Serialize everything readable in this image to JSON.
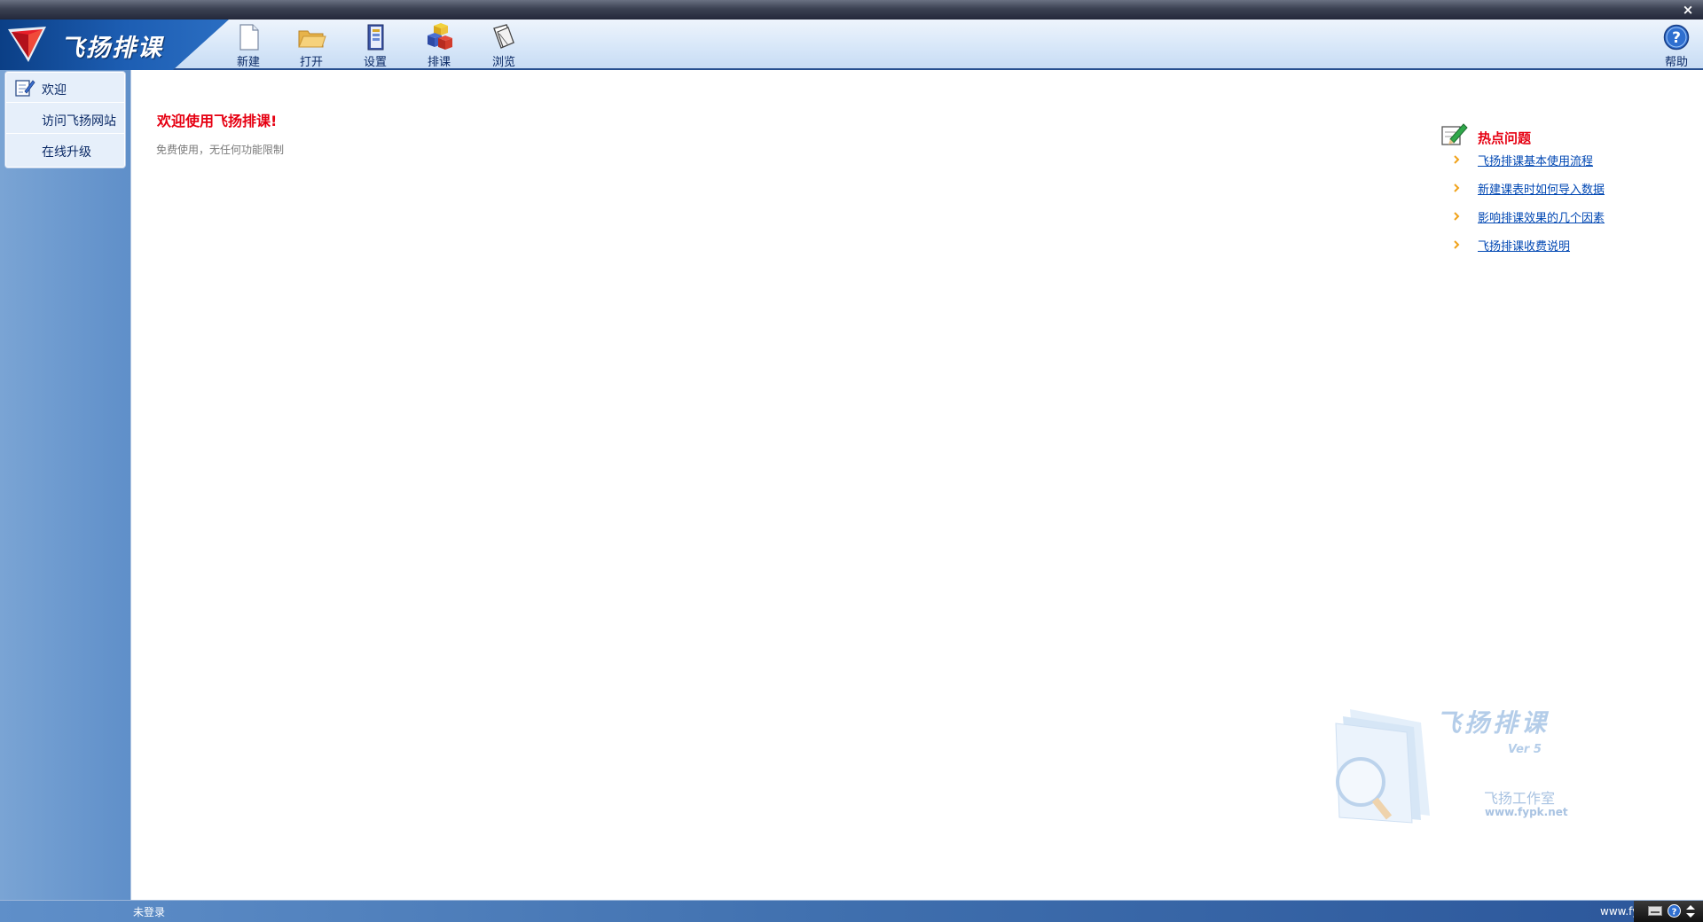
{
  "window": {
    "close_glyph": "×"
  },
  "brand": {
    "title": "飞扬排课",
    "logo_icon": "logo-triangle-icon"
  },
  "toolbar": [
    {
      "label": "新建",
      "icon": "new-file-icon"
    },
    {
      "label": "打开",
      "icon": "open-folder-icon"
    },
    {
      "label": "设置",
      "icon": "settings-book-icon"
    },
    {
      "label": "排课",
      "icon": "schedule-cubes-icon"
    },
    {
      "label": "浏览",
      "icon": "browse-pages-icon"
    }
  ],
  "help": {
    "label": "帮助",
    "icon": "help-icon"
  },
  "sidebar": {
    "items": [
      {
        "label": "欢迎",
        "icon": "welcome-icon"
      },
      {
        "label": "访问飞扬网站"
      },
      {
        "label": "在线升级"
      }
    ]
  },
  "main": {
    "welcome_title": "欢迎使用飞扬排课!",
    "welcome_sub": "免费使用，无任何功能限制",
    "hot": {
      "title": "热点问题",
      "icon": "pen-note-icon",
      "items": [
        "飞扬排课基本使用流程",
        "新建课表时如何导入数据",
        "影响排课效果的几个因素",
        "飞扬排课收费说明"
      ]
    },
    "watermark": {
      "title": "飞扬排课",
      "version": "Ver 5",
      "studio": "飞扬工作室",
      "url": "www.fypk.net"
    }
  },
  "status": {
    "text": "未登录",
    "url": "www.fypk.net"
  },
  "colors": {
    "accent": "#e60012",
    "brand": "#1d5eb3",
    "link": "#0047b3"
  }
}
